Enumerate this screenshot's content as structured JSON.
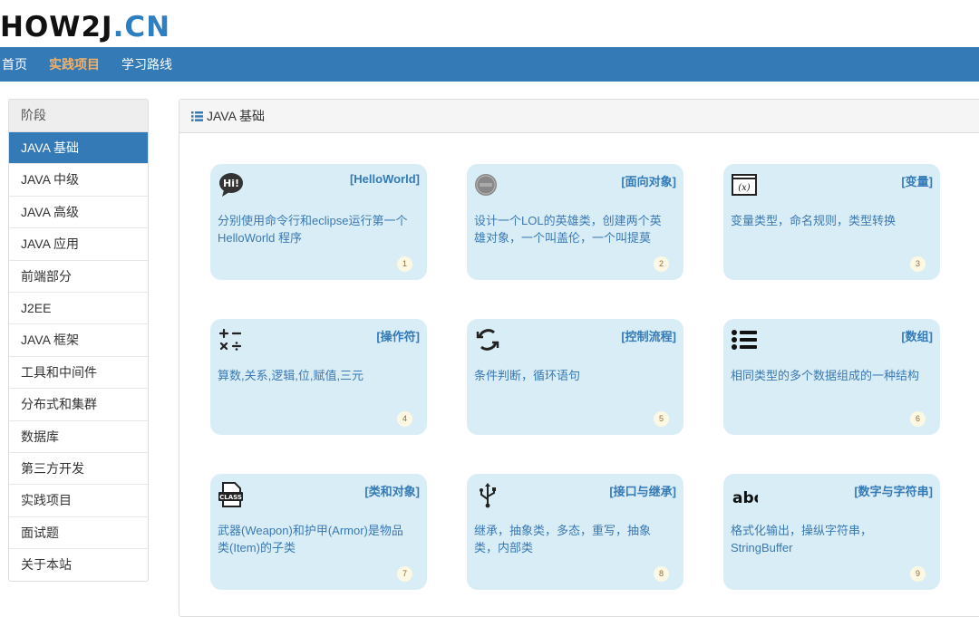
{
  "logo": {
    "part1": "HOW2J",
    "dot": ".",
    "part2": "CN"
  },
  "nav": [
    "首页",
    "实践项目",
    "学习路线"
  ],
  "sidebar": {
    "heading": "阶段",
    "items": [
      "JAVA 基础",
      "JAVA 中级",
      "JAVA 高级",
      "JAVA 应用",
      "前端部分",
      "J2EE",
      "JAVA 框架",
      "工具和中间件",
      "分布式和集群",
      "数据库",
      "第三方开发",
      "实践项目",
      "面试题",
      "关于本站"
    ]
  },
  "panel": {
    "title": "JAVA 基础"
  },
  "cards": [
    {
      "title": "[HelloWorld]",
      "desc": "分别使用命令行和eclipse运行第一个HelloWorld 程序",
      "num": "1",
      "icon": "hi-speech-bubble-icon"
    },
    {
      "title": "[面向对象]",
      "desc": "设计一个LOL的英雄类，创建两个英雄对象，一个叫盖伦，一个叫提莫",
      "num": "2",
      "icon": "class-badge-icon"
    },
    {
      "title": "[变量]",
      "desc": "变量类型，命名规则，类型转换",
      "num": "3",
      "icon": "variable-x-icon"
    },
    {
      "title": "[操作符]",
      "desc": "算数,关系,逻辑,位,赋值,三元",
      "num": "4",
      "icon": "math-operators-icon"
    },
    {
      "title": "[控制流程]",
      "desc": "条件判断，循环语句",
      "num": "5",
      "icon": "loop-arrows-icon"
    },
    {
      "title": "[数组]",
      "desc": "相同类型的多个数据组成的一种结构",
      "num": "6",
      "icon": "list-icon"
    },
    {
      "title": "[类和对象]",
      "desc": "武器(Weapon)和护甲(Armor)是物品类(Item)的子类",
      "num": "7",
      "icon": "class-file-icon",
      "icon_text": "CLASS"
    },
    {
      "title": "[接口与继承]",
      "desc": "继承，抽象类，多态，重写，抽象类，内部类",
      "num": "8",
      "icon": "usb-icon"
    },
    {
      "title": "[数字与字符串]",
      "desc": "格式化输出，操纵字符串，StringBuffer",
      "num": "9",
      "icon": "abc-spellcheck-icon",
      "icon_text": "abc"
    }
  ]
}
